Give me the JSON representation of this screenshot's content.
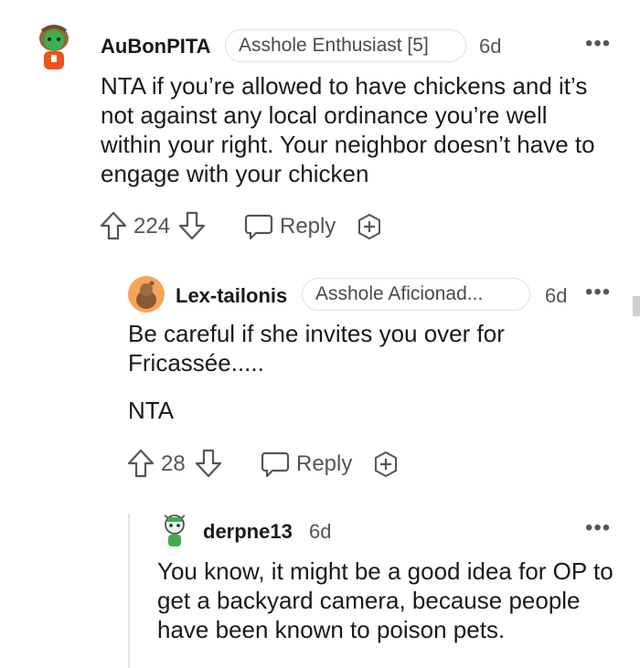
{
  "comments": [
    {
      "username": "AuBonPITA",
      "flair": "Asshole Enthusiast [5]",
      "age": "6d",
      "body": "NTA if you’re allowed to have chickens and it’s not against any local ordinance you’re well within your right. Your neighbor doesn’t have to engage with your chicken",
      "votes": "224",
      "reply_label": "Reply",
      "more_label": "•••"
    },
    {
      "username": "Lex-tailonis",
      "flair": "Asshole Aficionad...",
      "age": "6d",
      "body_line1": "Be careful if she invites you over for Fricassée.....",
      "body_line2": "NTA",
      "votes": "28",
      "reply_label": "Reply",
      "more_label": "•••"
    },
    {
      "username": "derpne13",
      "age": "6d",
      "body": "You know, it might be a good idea for OP to get a backyard camera, because people have been known to poison pets.",
      "more_label": "•••"
    }
  ],
  "icons": {
    "upvote": "upvote-arrow-icon",
    "downvote": "downvote-arrow-icon",
    "reply": "speech-bubble-icon",
    "award": "plus-circle-icon",
    "more": "more-dots-icon"
  },
  "colors": {
    "text": "#1a1a1b",
    "muted": "#555555",
    "flair_border": "#e0e0e0",
    "avatar_orange": "#f7a35c"
  }
}
